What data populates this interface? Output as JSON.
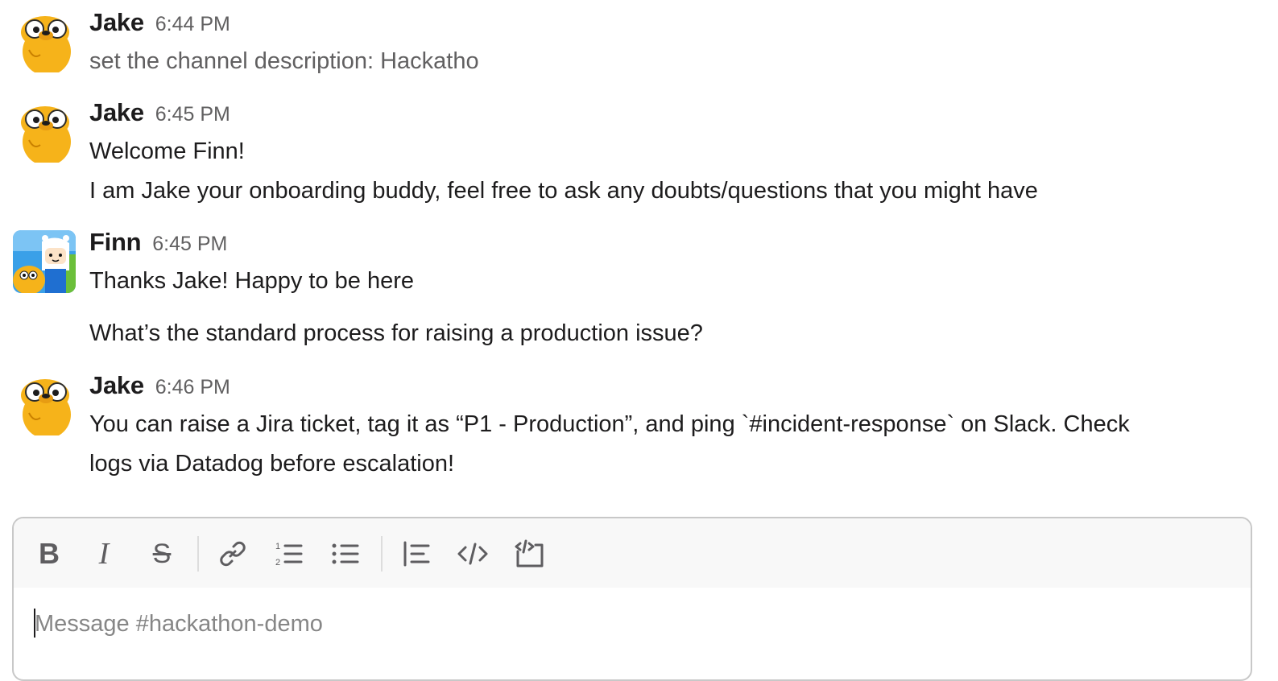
{
  "messages": [
    {
      "author": "Jake",
      "time": "6:44 PM",
      "avatar": "jake-avatar",
      "lines": [
        "set the channel description: Hackatho"
      ]
    },
    {
      "author": "Jake",
      "time": "6:45 PM",
      "avatar": "jake-avatar",
      "lines": [
        "Welcome Finn!",
        "I am Jake your onboarding buddy, feel free to ask any doubts/questions  that you might have"
      ]
    },
    {
      "author": "Finn",
      "time": "6:45 PM",
      "avatar": "finn-avatar",
      "lines": [
        "Thanks Jake! Happy to be here",
        "What’s the standard process for raising a production issue?"
      ]
    },
    {
      "author": "Jake",
      "time": "6:46 PM",
      "avatar": "jake-avatar",
      "lines": [
        "You can raise a Jira ticket, tag it as “P1 - Production”, and ping `#incident-response` on Slack. Check",
        "logs via Datadog before escalation!"
      ]
    }
  ],
  "composer": {
    "placeholder": "Message #hackathon-demo",
    "toolbar": [
      {
        "name": "bold-icon",
        "glyph": "B"
      },
      {
        "name": "italic-icon",
        "glyph": "I"
      },
      {
        "name": "strikethrough-icon",
        "glyph": "S"
      },
      {
        "name": "link-icon",
        "glyph": "link"
      },
      {
        "name": "ordered-list-icon",
        "glyph": "ol"
      },
      {
        "name": "bulleted-list-icon",
        "glyph": "ul"
      },
      {
        "name": "blockquote-icon",
        "glyph": "quote"
      },
      {
        "name": "code-icon",
        "glyph": "</>"
      },
      {
        "name": "code-block-icon",
        "glyph": "codeblock"
      }
    ]
  },
  "colors": {
    "jake": "#f6b31a",
    "finn_sky": "#3aa0e8",
    "text": "#1d1c1d",
    "muted": "#616061"
  }
}
